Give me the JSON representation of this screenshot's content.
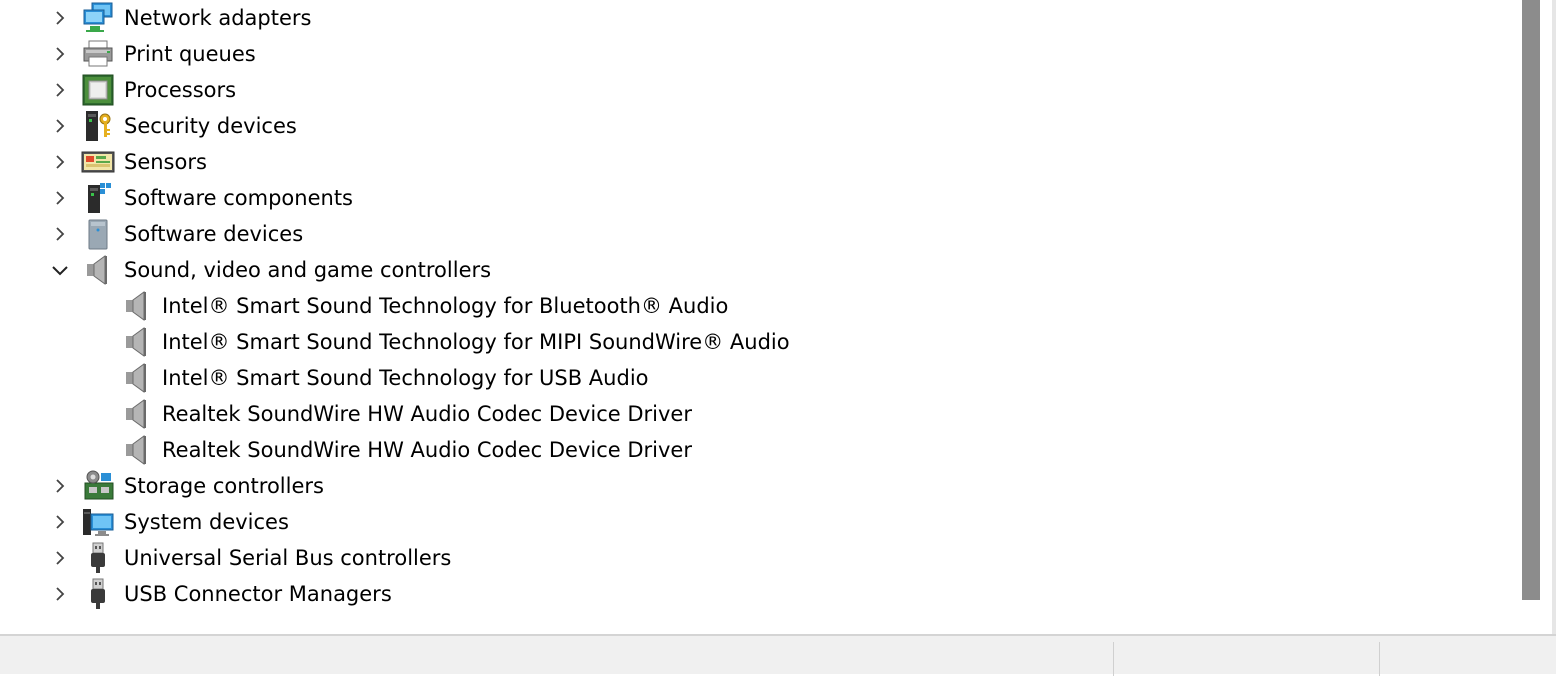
{
  "tree": {
    "categories_before": [
      {
        "label": "Network adapters",
        "icon": "network-adapter-icon",
        "expanded": false
      },
      {
        "label": "Print queues",
        "icon": "printer-icon",
        "expanded": false
      },
      {
        "label": "Processors",
        "icon": "processor-chip-icon",
        "expanded": false
      },
      {
        "label": "Security devices",
        "icon": "security-key-icon",
        "expanded": false
      },
      {
        "label": "Sensors",
        "icon": "sensor-icon",
        "expanded": false
      },
      {
        "label": "Software components",
        "icon": "software-component-icon",
        "expanded": false
      },
      {
        "label": "Software devices",
        "icon": "software-device-icon",
        "expanded": false
      }
    ],
    "expanded_category": {
      "label": "Sound, video and game controllers",
      "icon": "speaker-icon",
      "expanded": true,
      "children": [
        {
          "label": "Intel® Smart Sound Technology for Bluetooth® Audio",
          "icon": "speaker-icon"
        },
        {
          "label": "Intel® Smart Sound Technology for MIPI SoundWire® Audio",
          "icon": "speaker-icon"
        },
        {
          "label": "Intel® Smart Sound Technology for USB Audio",
          "icon": "speaker-icon"
        },
        {
          "label": "Realtek SoundWire HW Audio Codec Device Driver",
          "icon": "speaker-icon"
        },
        {
          "label": "Realtek SoundWire HW Audio Codec Device Driver",
          "icon": "speaker-icon"
        }
      ]
    },
    "categories_after": [
      {
        "label": "Storage controllers",
        "icon": "storage-controller-icon",
        "expanded": false
      },
      {
        "label": "System devices",
        "icon": "system-device-icon",
        "expanded": false
      },
      {
        "label": "Universal Serial Bus controllers",
        "icon": "usb-plug-icon",
        "expanded": false
      },
      {
        "label": "USB Connector Managers",
        "icon": "usb-plug-icon",
        "expanded": false
      }
    ]
  },
  "status_bar": {
    "sections": [
      "",
      "",
      ""
    ]
  },
  "colors": {
    "background": "#ffffff",
    "scrollbar_thumb": "#8c8c8c",
    "status_bar": "#f0f0f0"
  }
}
